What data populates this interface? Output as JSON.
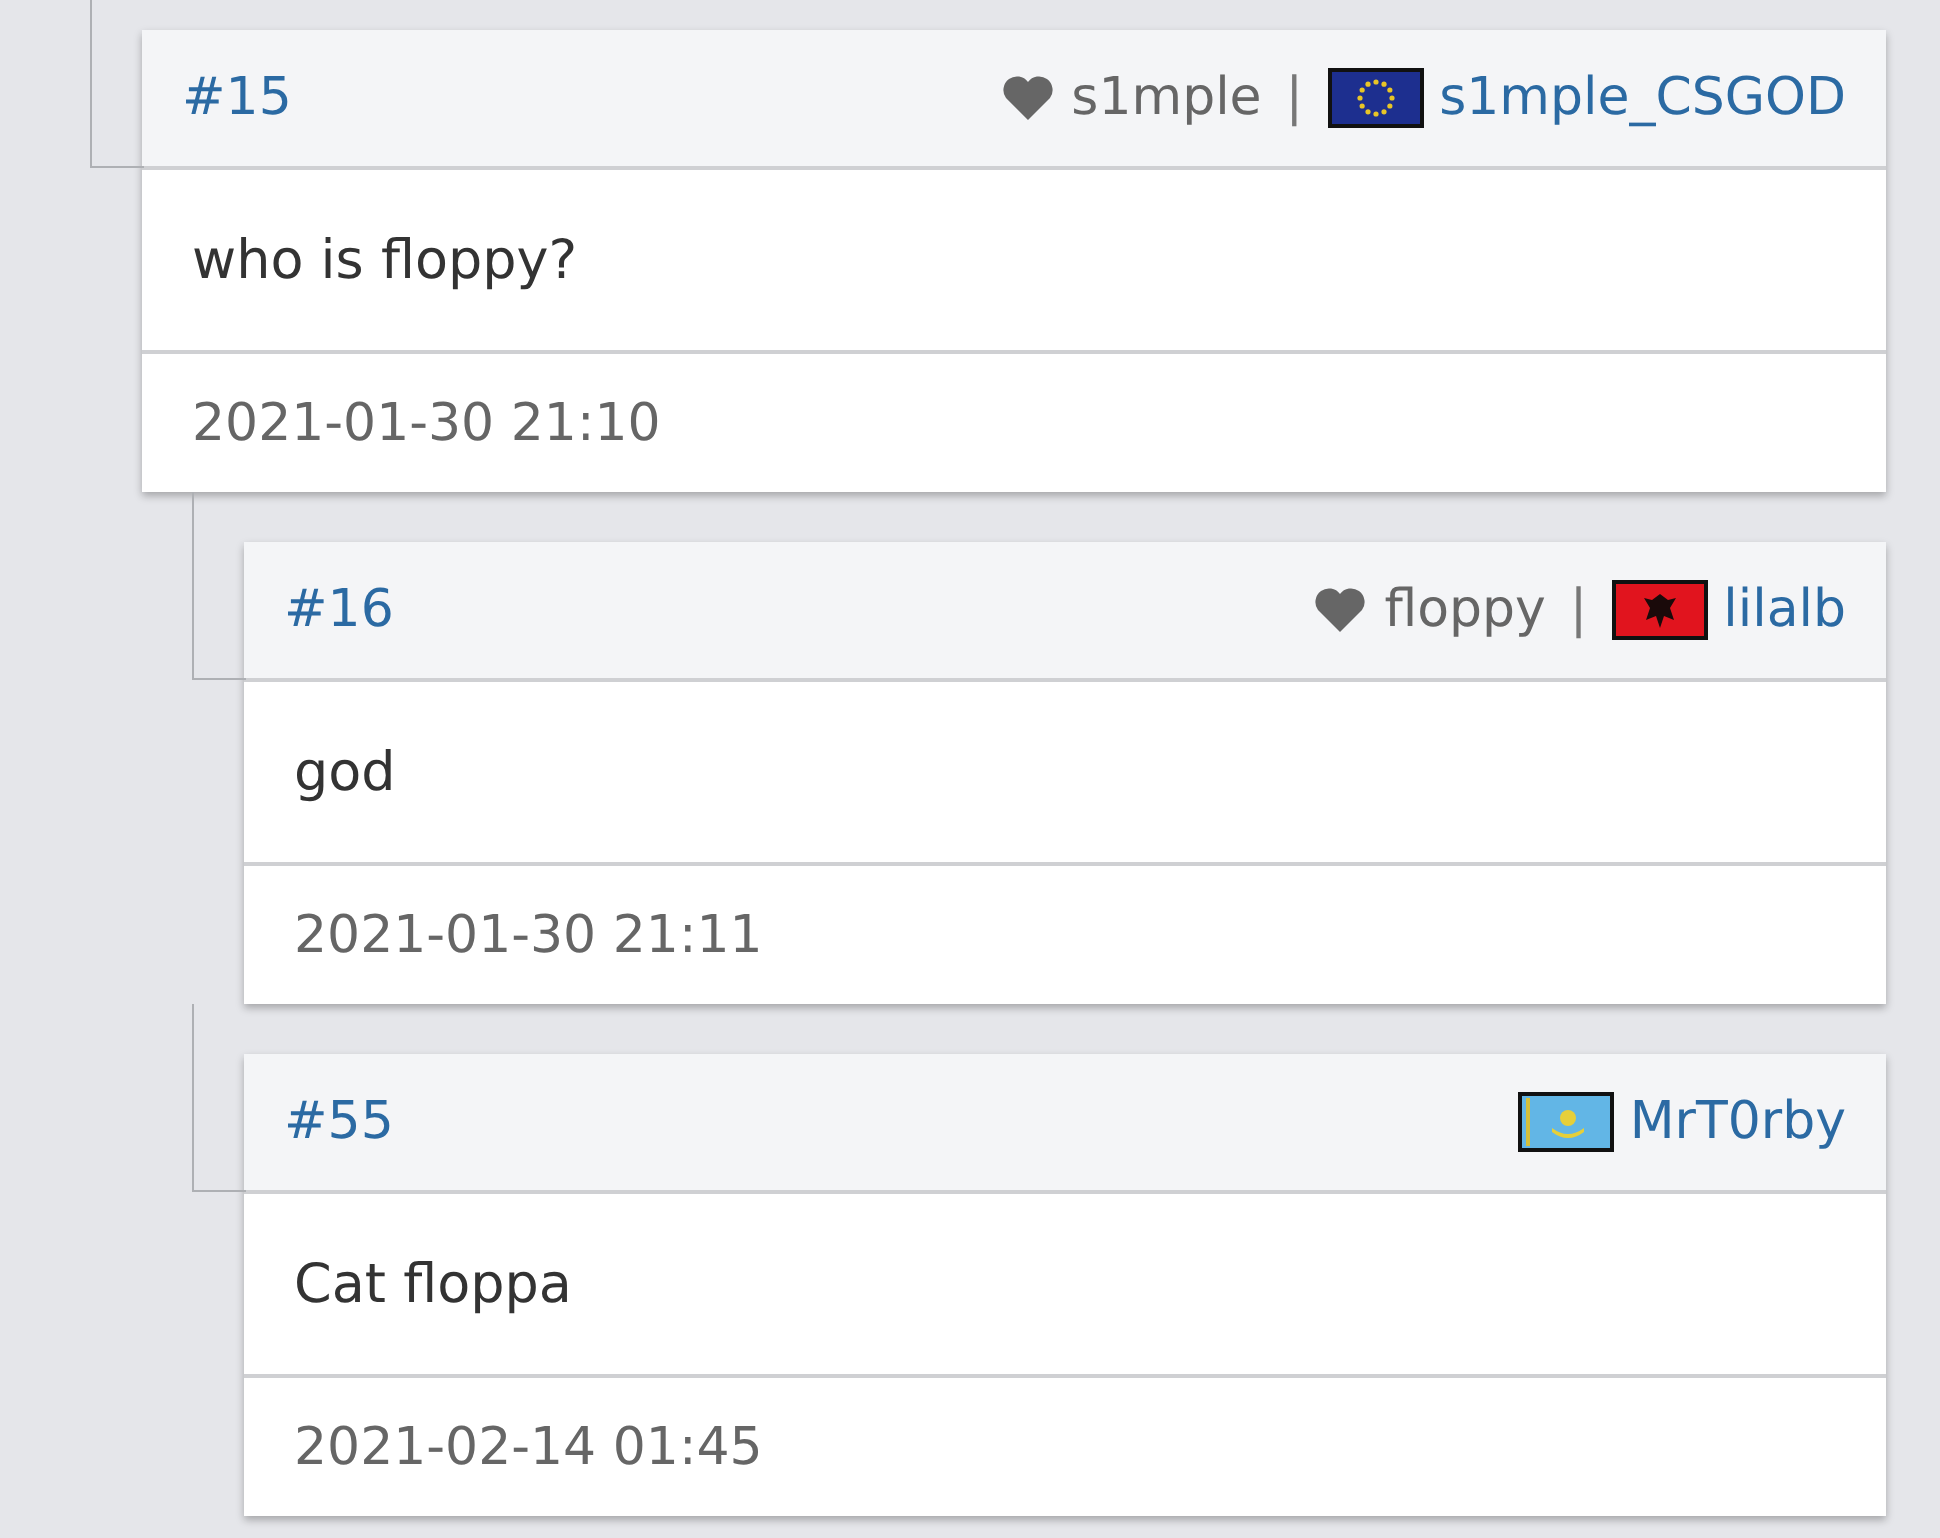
{
  "posts": [
    {
      "number": "#15",
      "fan_of": "s1mple",
      "separator": "|",
      "flag": {
        "kind": "eu"
      },
      "author": "s1mple_CSGOD",
      "text": "who is floppy?",
      "date": "2021-01-30 21:10",
      "children": [
        {
          "number": "#16",
          "fan_of": "floppy",
          "separator": "|",
          "flag": {
            "kind": "al"
          },
          "author": "lilalb",
          "text": "god",
          "date": "2021-01-30 21:11"
        },
        {
          "number": "#55",
          "flag": {
            "kind": "kz"
          },
          "author": "MrT0rby",
          "text": "Cat floppa",
          "date": "2021-02-14 01:45"
        }
      ]
    }
  ]
}
